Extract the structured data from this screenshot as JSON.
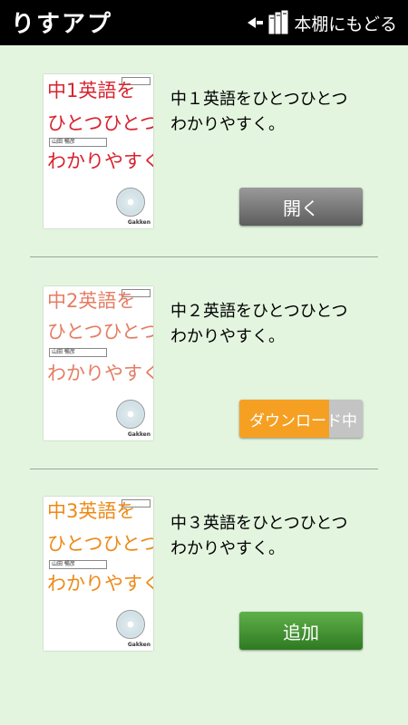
{
  "header": {
    "app_title": "りすアプ",
    "back_label": "本棚にもどる",
    "icons": [
      "back-arrow-icon",
      "books-icon"
    ]
  },
  "books": [
    {
      "cover_title_line1": "中1英語を",
      "cover_title_line2": "ひとつひとつ",
      "cover_title_line3": "わかりやすく。",
      "cover_color": "#d7232f",
      "author": "山田 暢彦",
      "publisher": "Gakken",
      "description": "中１英語をひとつひとつ\nわかりやすく。",
      "action_label": "開く",
      "action_state": "open"
    },
    {
      "cover_title_line1": "中2英語を",
      "cover_title_line2": "ひとつひとつ",
      "cover_title_line3": "わかりやすく。",
      "cover_color": "#e57d63",
      "author": "山田 暢彦",
      "publisher": "Gakken",
      "description": "中２英語をひとつひとつ\nわかりやすく。",
      "action_label": "ダウンロード中",
      "action_state": "downloading",
      "download_progress": 0.73
    },
    {
      "cover_title_line1": "中3英語を",
      "cover_title_line2": "ひとつひとつ",
      "cover_title_line3": "わかりやすく。",
      "cover_color": "#ec8a16",
      "author": "山田 暢彦",
      "publisher": "Gakken",
      "description": "中３英語をひとつひとつ\nわかりやすく。",
      "action_label": "追加",
      "action_state": "add"
    }
  ],
  "colors": {
    "background": "#e3f5df",
    "header": "#000000",
    "open_button": "#7a7a7a",
    "download_fill": "#f5a023",
    "add_button": "#3f9330"
  }
}
